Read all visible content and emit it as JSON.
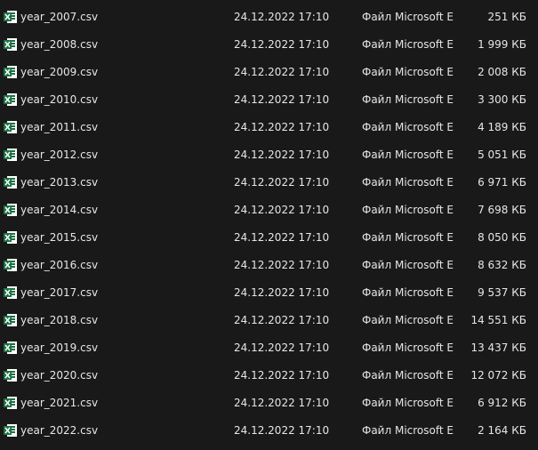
{
  "files": [
    {
      "name": "year_2007.csv",
      "date": "24.12.2022 17:10",
      "type": "Файл Microsoft E...",
      "size": "251 КБ"
    },
    {
      "name": "year_2008.csv",
      "date": "24.12.2022 17:10",
      "type": "Файл Microsoft E...",
      "size": "1 999 КБ"
    },
    {
      "name": "year_2009.csv",
      "date": "24.12.2022 17:10",
      "type": "Файл Microsoft E...",
      "size": "2 008 КБ"
    },
    {
      "name": "year_2010.csv",
      "date": "24.12.2022 17:10",
      "type": "Файл Microsoft E...",
      "size": "3 300 КБ"
    },
    {
      "name": "year_2011.csv",
      "date": "24.12.2022 17:10",
      "type": "Файл Microsoft E...",
      "size": "4 189 КБ"
    },
    {
      "name": "year_2012.csv",
      "date": "24.12.2022 17:10",
      "type": "Файл Microsoft E...",
      "size": "5 051 КБ"
    },
    {
      "name": "year_2013.csv",
      "date": "24.12.2022 17:10",
      "type": "Файл Microsoft E...",
      "size": "6 971 КБ"
    },
    {
      "name": "year_2014.csv",
      "date": "24.12.2022 17:10",
      "type": "Файл Microsoft E...",
      "size": "7 698 КБ"
    },
    {
      "name": "year_2015.csv",
      "date": "24.12.2022 17:10",
      "type": "Файл Microsoft E...",
      "size": "8 050 КБ"
    },
    {
      "name": "year_2016.csv",
      "date": "24.12.2022 17:10",
      "type": "Файл Microsoft E...",
      "size": "8 632 КБ"
    },
    {
      "name": "year_2017.csv",
      "date": "24.12.2022 17:10",
      "type": "Файл Microsoft E...",
      "size": "9 537 КБ"
    },
    {
      "name": "year_2018.csv",
      "date": "24.12.2022 17:10",
      "type": "Файл Microsoft E...",
      "size": "14 551 КБ"
    },
    {
      "name": "year_2019.csv",
      "date": "24.12.2022 17:10",
      "type": "Файл Microsoft E...",
      "size": "13 437 КБ"
    },
    {
      "name": "year_2020.csv",
      "date": "24.12.2022 17:10",
      "type": "Файл Microsoft E...",
      "size": "12 072 КБ"
    },
    {
      "name": "year_2021.csv",
      "date": "24.12.2022 17:10",
      "type": "Файл Microsoft E...",
      "size": "6 912 КБ"
    },
    {
      "name": "year_2022.csv",
      "date": "24.12.2022 17:10",
      "type": "Файл Microsoft E...",
      "size": "2 164 КБ"
    }
  ],
  "icon": {
    "name": "excel-csv-file-icon",
    "color": "#1d7044",
    "accent": "#ffffff"
  }
}
